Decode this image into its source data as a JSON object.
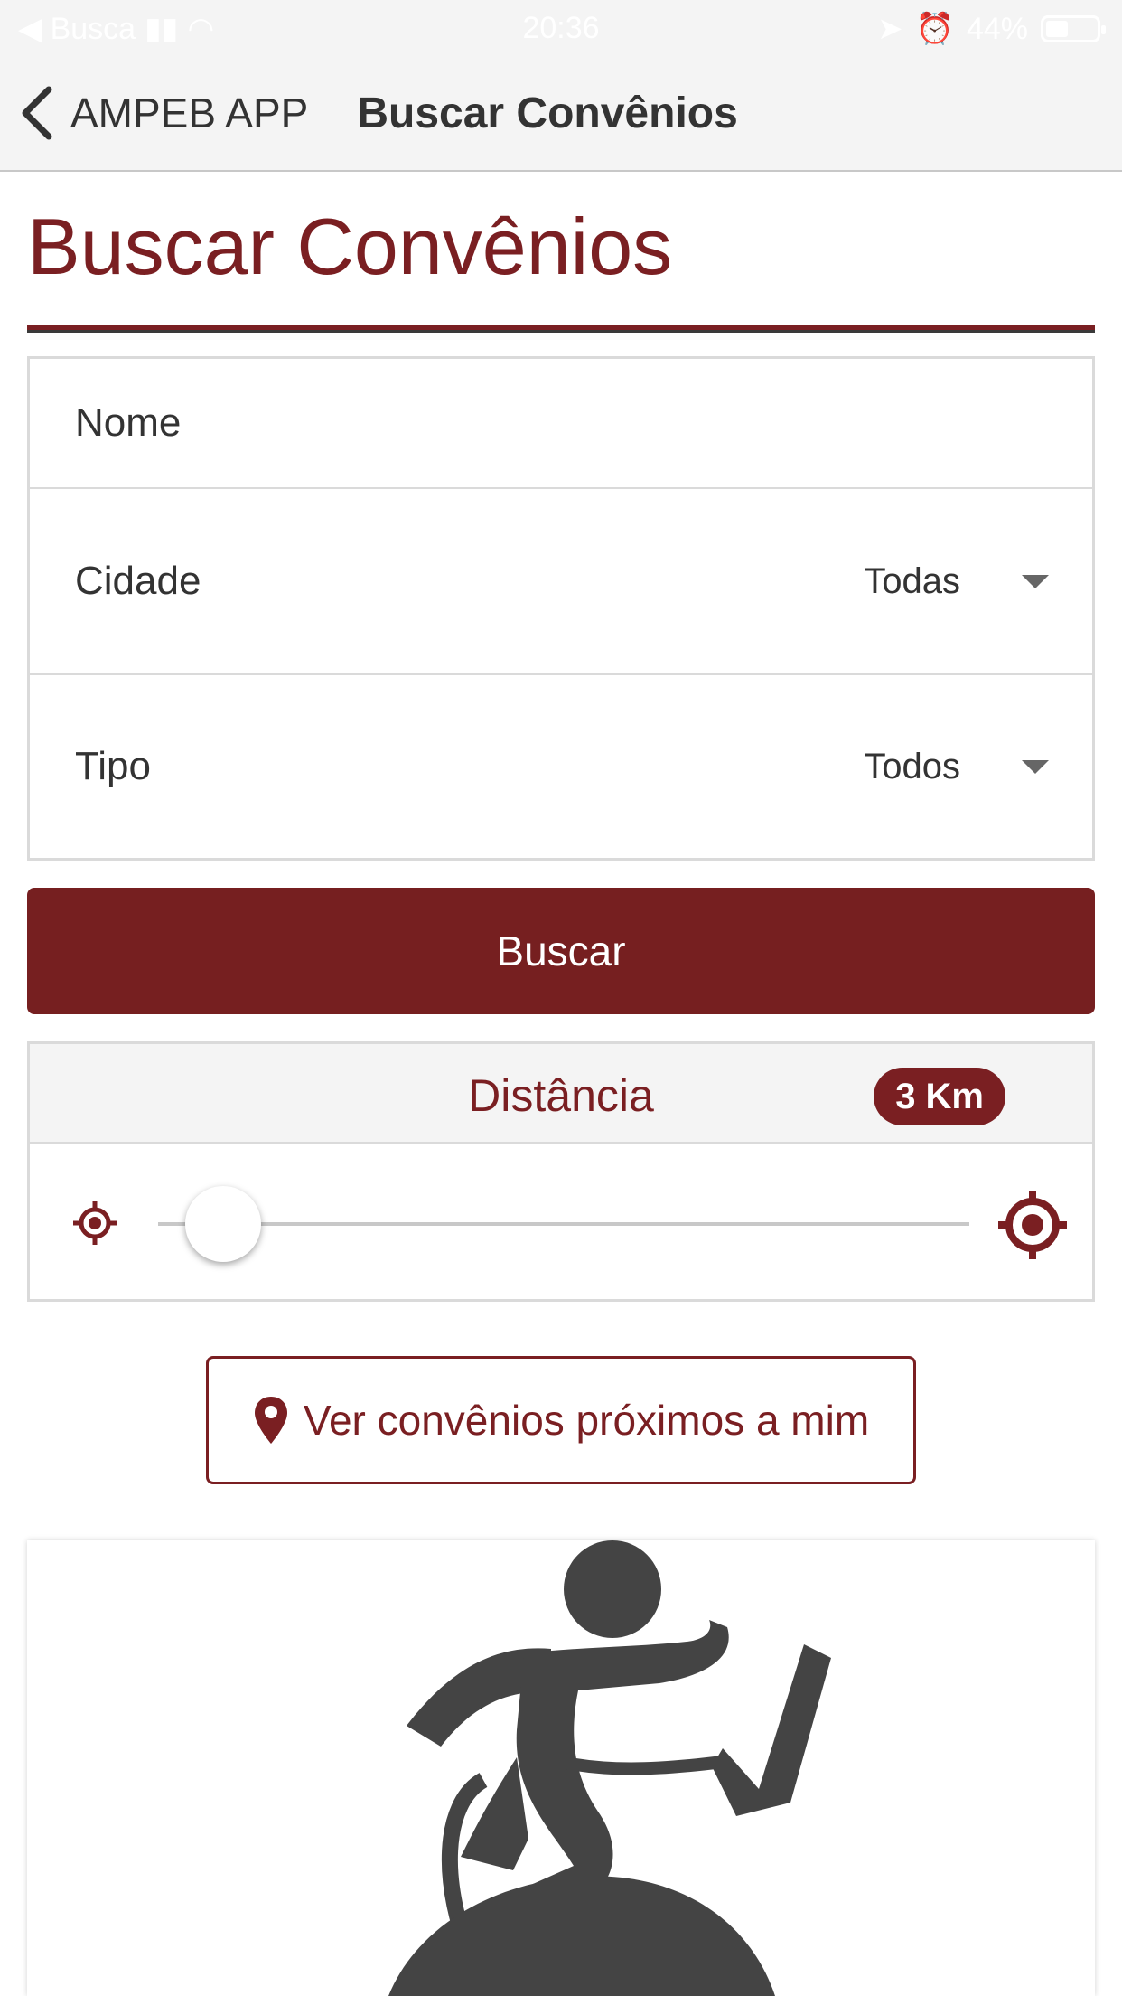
{
  "status_bar": {
    "back_app": "◀ Busca",
    "time": "20:36",
    "battery": "44%"
  },
  "nav": {
    "back_label": "AMPEB APP",
    "title": "Buscar Convênios"
  },
  "page": {
    "heading": "Buscar Convênios"
  },
  "form": {
    "nome_label": "Nome",
    "cidade_label": "Cidade",
    "cidade_value": "Todas",
    "tipo_label": "Tipo",
    "tipo_value": "Todos",
    "submit_label": "Buscar"
  },
  "distance": {
    "label": "Distância",
    "badge": "3 Km"
  },
  "near_button": {
    "label": "Ver convênios próximos a mim"
  },
  "colors": {
    "accent": "#7a1f22",
    "button_fill": "#761f20",
    "icon_gray": "#444444"
  }
}
